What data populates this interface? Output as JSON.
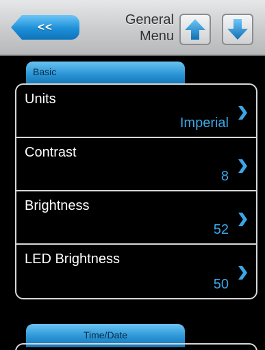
{
  "header": {
    "back_label": "<<",
    "title_line1": "General",
    "title_line2": "Menu"
  },
  "sections": {
    "basic_label": "Basic",
    "time_label": "Time/Date"
  },
  "rows": [
    {
      "label": "Units",
      "value": "Imperial"
    },
    {
      "label": "Contrast",
      "value": "8"
    },
    {
      "label": "Brightness",
      "value": "52"
    },
    {
      "label": "LED Brightness",
      "value": "50"
    }
  ],
  "colors": {
    "accent": "#2a95d6",
    "value_text": "#3aa6e6"
  }
}
